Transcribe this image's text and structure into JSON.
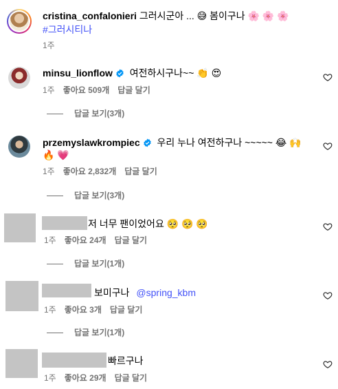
{
  "post_caption": {
    "username": "cristina_confalonieri",
    "text": "그러시군아 ... 😅 봄이구나 🌸 🌸 🌸",
    "hashtag": "#그러시티나",
    "time": "1주"
  },
  "comments": [
    {
      "username": "minsu_lionflow",
      "verified": true,
      "text": "여전하시구나~~ 👏 😍",
      "time": "1주",
      "likes": "좋아요 509개",
      "reply": "답글 달기",
      "view_replies": "답글 보기(3개)"
    },
    {
      "username": "przemyslawkrompiec",
      "verified": true,
      "text_line1": "우리 누나 여전하구나 ~~~~~ 😂 🙌",
      "text_line2": "🔥 💗",
      "time": "1주",
      "likes": "좋아요 2,832개",
      "reply": "답글 달기",
      "view_replies": "답글 보기(3개)"
    },
    {
      "username": "",
      "text": "저 너무 팬이었어요 🥺 🥺 🥺",
      "time": "1주",
      "likes": "좋아요 24개",
      "reply": "답글 달기",
      "view_replies": "답글 보기(1개)"
    },
    {
      "username": "",
      "text": "보미구나",
      "mention": "@spring_kbm",
      "time": "1주",
      "likes": "좋아요 3개",
      "reply": "답글 달기",
      "view_replies": "답글 보기(1개)"
    },
    {
      "username": "",
      "text": "빠르구나",
      "time": "1주",
      "likes": "좋아요 29개",
      "reply": "답글 달기"
    }
  ],
  "icons": {
    "heart": "heart-outline-icon",
    "verified": "verified-badge-icon"
  },
  "colors": {
    "link": "#4150f7",
    "meta": "#737373",
    "verified": "#0095f6",
    "redacted": "#c4c4c4"
  }
}
